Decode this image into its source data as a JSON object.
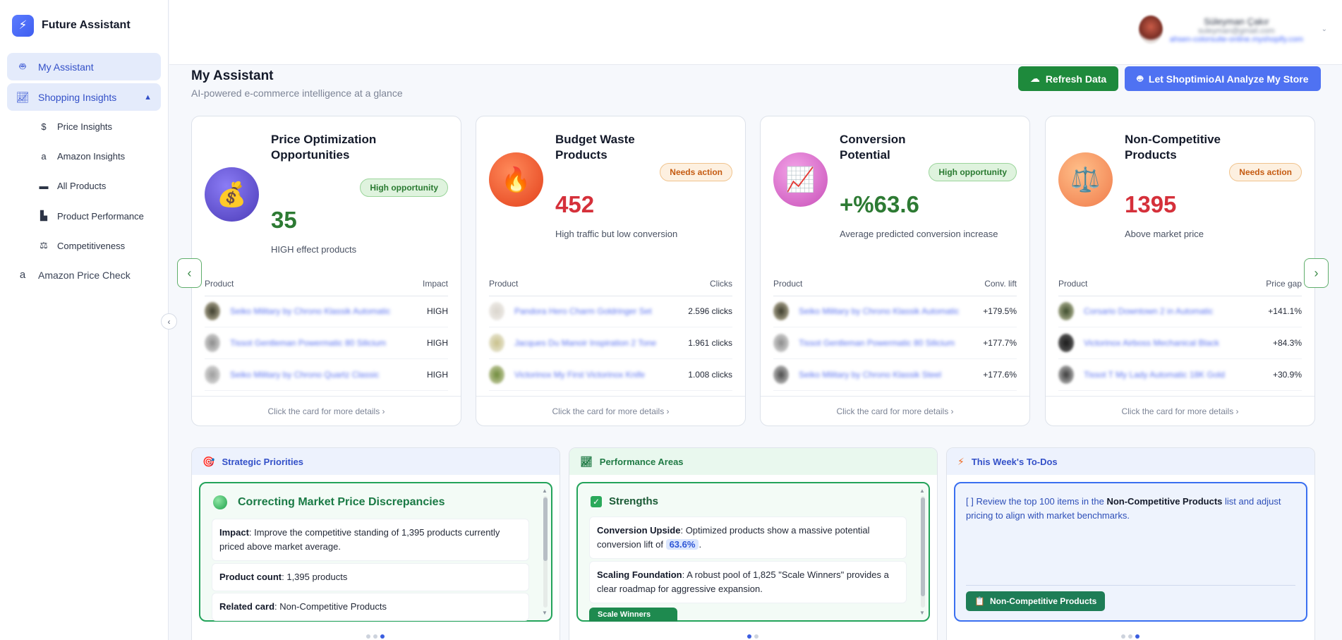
{
  "app": {
    "name": "Future Assistant",
    "logo_icon": "bolt-icon"
  },
  "sidebar": {
    "items": [
      {
        "label": "My Assistant",
        "icon": "robot-icon"
      },
      {
        "label": "Shopping Insights",
        "icon": "chart-line-icon"
      },
      {
        "label": "Amazon Price Check",
        "icon": "amazon-icon"
      }
    ],
    "subitems": [
      {
        "label": "Price Insights",
        "icon": "dollar-icon"
      },
      {
        "label": "Amazon Insights",
        "icon": "amazon-icon"
      },
      {
        "label": "All Products",
        "icon": "box-icon"
      },
      {
        "label": "Product Performance",
        "icon": "bar-chart-icon"
      },
      {
        "label": "Competitiveness",
        "icon": "scale-icon"
      }
    ]
  },
  "user": {
    "name": "Süleyman Çakır",
    "email": "suleyman@gmail.com",
    "shop": "ahsen-colorsuite-online.myshopify.com"
  },
  "header": {
    "title": "My Assistant",
    "subtitle": "AI-powered e-commerce intelligence at a glance",
    "refresh_label": "Refresh Data",
    "analyze_label": "Let ShoptimioAI Analyze My Store"
  },
  "cards": [
    {
      "title": "Price Optimization Opportunities",
      "badge": "High opportunity",
      "value": "35",
      "desc": "HIGH effect products",
      "col_product": "Product",
      "col_metric": "Impact",
      "rows": [
        {
          "name": "Seiko Military by Chrono Klassik Automatic",
          "val": "HIGH"
        },
        {
          "name": "Tissot Gentleman Powermatic 80 Silicium",
          "val": "HIGH"
        },
        {
          "name": "Seiko Military by Chrono Quartz Classic",
          "val": "HIGH"
        }
      ],
      "footer": "Click the card for more details ›"
    },
    {
      "title": "Budget Waste Products",
      "badge": "Needs action",
      "value": "452",
      "desc": "High traffic but low conversion",
      "col_product": "Product",
      "col_metric": "Clicks",
      "rows": [
        {
          "name": "Pandora Hero Charm Goldringer Set",
          "val": "2.596 clicks"
        },
        {
          "name": "Jacques Du Manoir Inspiration 2 Tone",
          "val": "1.961 clicks"
        },
        {
          "name": "Victorinox My First Victorinox Knife",
          "val": "1.008 clicks"
        }
      ],
      "footer": "Click the card for more details ›"
    },
    {
      "title": "Conversion Potential",
      "badge": "High opportunity",
      "value": "+%63.6",
      "desc": "Average predicted conversion increase",
      "col_product": "Product",
      "col_metric": "Conv. lift",
      "rows": [
        {
          "name": "Seiko Military by Chrono Klassik Automatic",
          "val": "+179.5%"
        },
        {
          "name": "Tissot Gentleman Powermatic 80 Silicium",
          "val": "+177.7%"
        },
        {
          "name": "Seiko Military by Chrono Klassik Steel",
          "val": "+177.6%"
        }
      ],
      "footer": "Click the card for more details ›"
    },
    {
      "title": "Non-Competitive Products",
      "badge": "Needs action",
      "value": "1395",
      "desc": "Above market price",
      "col_product": "Product",
      "col_metric": "Price gap",
      "rows": [
        {
          "name": "Corsario Downtown 2 in Automatic",
          "val": "+141.1%"
        },
        {
          "name": "Victorinox Airboss Mechanical Black",
          "val": "+84.3%"
        },
        {
          "name": "Tissot T My Lady Automatic 18K Gold",
          "val": "+30.9%"
        }
      ],
      "footer": "Click the card for more details ›"
    }
  ],
  "panels": {
    "strategic": {
      "title": "Strategic Priorities",
      "heading": "Correcting Market Price Discrepancies",
      "impact_label": "Impact",
      "impact_text": ": Improve the competitive standing of 1,395 products currently priced above market average.",
      "count_label": "Product count",
      "count_text": ": 1,395 products",
      "related_label": "Related card",
      "related_text": ": Non-Competitive Products"
    },
    "performance": {
      "title": "Performance Areas",
      "heading": "Strengths",
      "upside_label": "Conversion Upside",
      "upside_text": ": Optimized products show a massive potential conversion lift of",
      "upside_value": "63.6%",
      "upside_end": ".",
      "scaling_label": "Scaling Foundation",
      "scaling_text": ": A robust pool of 1,825 \"Scale Winners\" provides a clear roadmap for aggressive expansion.",
      "partial_button": "Scale Winners"
    },
    "todos": {
      "title": "This Week's To-Dos",
      "text_before": "[ ] Review the top 100 items in the ",
      "text_bold": "Non-Competitive Products",
      "text_after": " list and adjust pricing to align with market benchmarks.",
      "button": "Non-Competitive Products"
    }
  },
  "colors": {
    "accent": "#4f72f2",
    "green": "#1e8a3c",
    "red": "#d5303a",
    "orange": "#c55b12"
  }
}
